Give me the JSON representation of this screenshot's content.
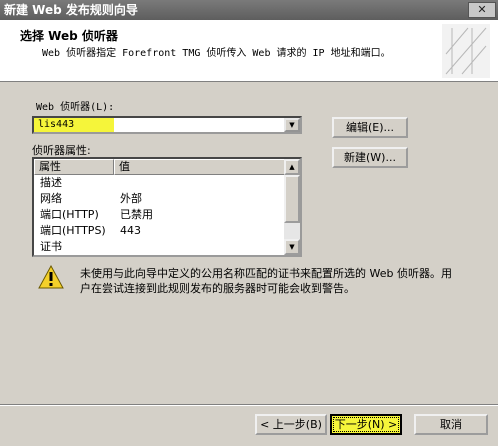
{
  "window": {
    "title": "新建 Web 发布规则向导",
    "close_label": "✕"
  },
  "header": {
    "title": "选择 Web 侦听器",
    "description": "Web 侦听器指定 Forefront TMG 侦听传入 Web 请求的 IP 地址和端口。"
  },
  "listener": {
    "label": "Web 侦听器(L):",
    "selected": "lis443",
    "edit_button": "编辑(E)...",
    "new_button": "新建(W)..."
  },
  "properties": {
    "label": "侦听器属性:",
    "columns": [
      "属性",
      "值"
    ],
    "rows": [
      {
        "name": "描述",
        "value": ""
      },
      {
        "name": "网络",
        "value": "外部"
      },
      {
        "name": "端口(HTTP)",
        "value": "已禁用"
      },
      {
        "name": "端口(HTTPS)",
        "value": "443"
      },
      {
        "name": "证书",
        "value": ""
      }
    ]
  },
  "warning": {
    "icon": "warning-triangle-icon",
    "text": "未使用与此向导中定义的公用名称匹配的证书来配置所选的 Web 侦听器。用户在尝试连接到此规则发布的服务器时可能会收到警告。"
  },
  "footer": {
    "back_button": "< 上一步(B)",
    "next_button": "下一步(N) >",
    "cancel_button": "取消"
  },
  "colors": {
    "highlight": "#f5f53a",
    "dialog": "#d4d0c8",
    "titlebar": "#6a6a6a"
  }
}
